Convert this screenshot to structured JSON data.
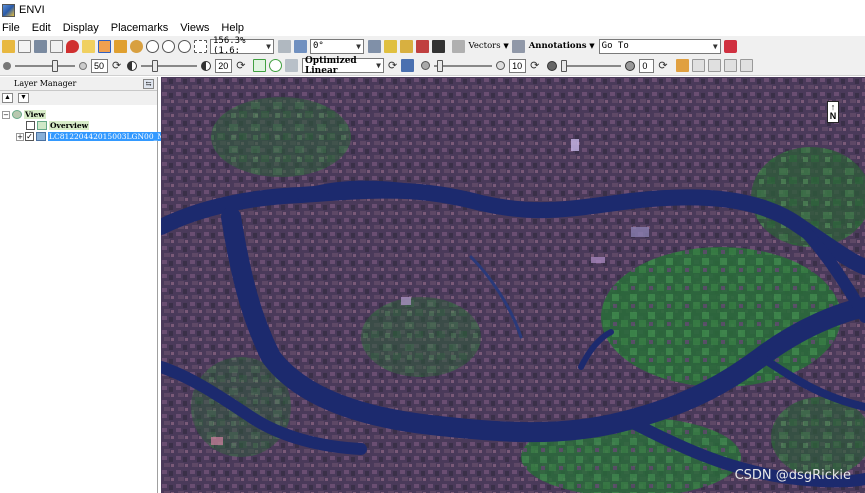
{
  "window": {
    "title": "ENVI"
  },
  "menu": [
    "File",
    "Edit",
    "Display",
    "Placemarks",
    "Views",
    "Help"
  ],
  "toolbar1": {
    "zoom_value": "156.3% (1.6:",
    "rotation_value": "0°",
    "vectors_label": "Vectors",
    "annotations_label": "Annotations",
    "goto_value": "Go To"
  },
  "toolbar2": {
    "brightness_value": "50",
    "contrast_value": "20",
    "stretch_value": "Optimized Linear",
    "sharpen_value": "10",
    "transparency_value": "0"
  },
  "layer_manager": {
    "title": "Layer Manager",
    "tree": {
      "view_label": "View",
      "overview_label": "Overview",
      "layer_label": "LC81220442015003LGN00_MTL"
    }
  },
  "map": {
    "north_label": "N",
    "watermark": "CSDN @dsgRickie"
  },
  "colors": {
    "river": "#1c2a6e",
    "urban": "#5c4868",
    "vegetation": "#2f6a3a",
    "selection": "#3399ff"
  }
}
